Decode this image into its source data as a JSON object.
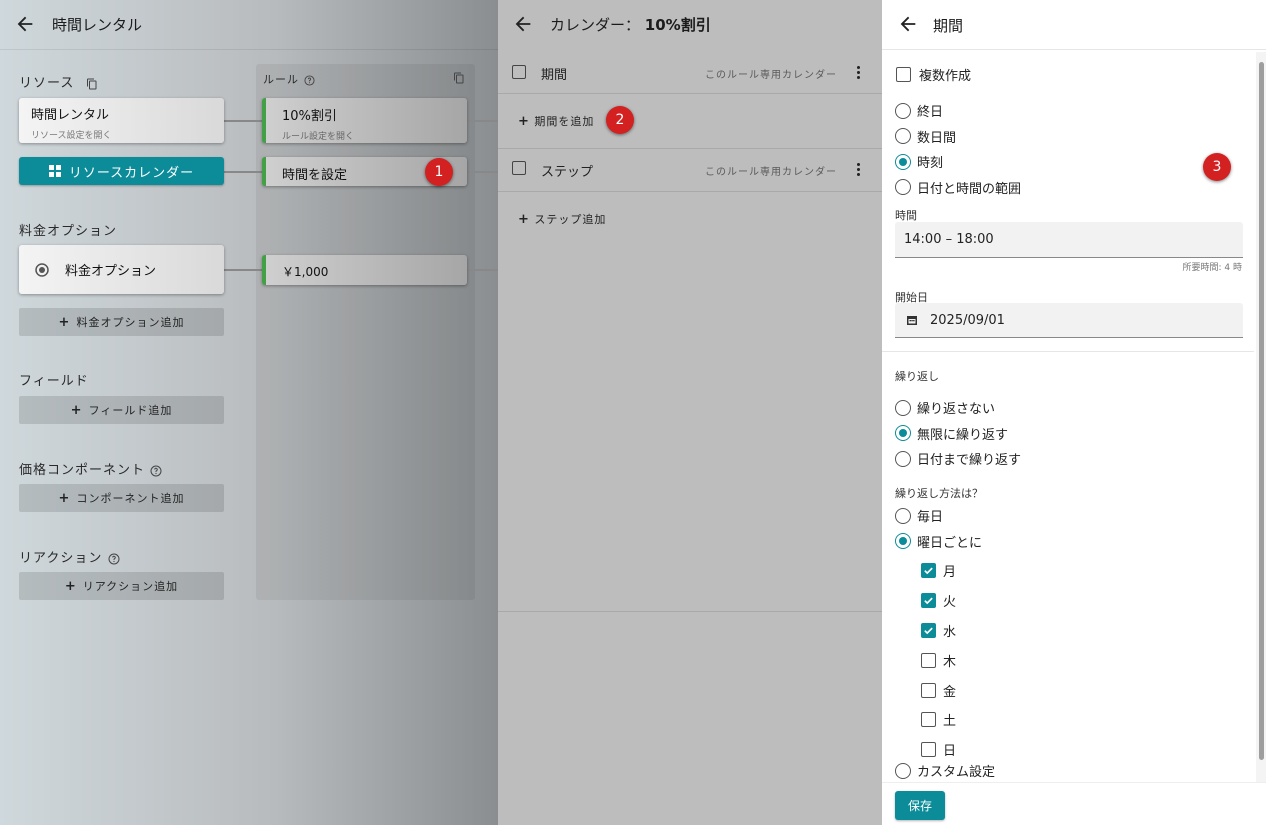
{
  "panel1": {
    "title": "時間レンタル",
    "resources_label": "リソース",
    "rules_label": "ルール",
    "resource_card": {
      "title": "時間レンタル",
      "subtitle": "リソース設定を開く"
    },
    "resource_calendar_button": "リソースカレンダー",
    "rule_card": {
      "title": "10%割引",
      "subtitle": "ルール設定を開く"
    },
    "set_time_card": "時間を設定",
    "price_options_label": "料金オプション",
    "price_option_card": "料金オプション",
    "price_value_card": "￥1,000",
    "add_price_option": "料金オプション追加",
    "fields_label": "フィールド",
    "add_field": "フィールド追加",
    "price_component_label": "価格コンポーネント",
    "add_component": "コンポーネント追加",
    "reaction_label": "リアクション",
    "add_reaction": "リアクション追加"
  },
  "panel2": {
    "title": "カレンダー：",
    "title_rule": "10%割引",
    "period_label": "期間",
    "period_note": "このルール専用カレンダー",
    "add_period": "期間を追加",
    "step_label": "ステップ",
    "step_note": "このルール専用カレンダー",
    "add_step": "ステップ追加"
  },
  "panel3": {
    "title": "期間",
    "multi_create": "複数作成",
    "duration_options": [
      "終日",
      "数日間",
      "時刻",
      "日付と時間の範囲"
    ],
    "duration_selected": "時刻",
    "time_label": "時間",
    "time_value": "14:00 – 18:00",
    "time_hint": "所要時間: 4 時",
    "start_label": "開始日",
    "start_value": "2025/09/01",
    "repeat_label": "繰り返し",
    "repeat_options": [
      "繰り返さない",
      "無限に繰り返す",
      "日付まで繰り返す"
    ],
    "repeat_selected": "無限に繰り返す",
    "method_label": "繰り返し方法は？",
    "method_options": [
      "毎日",
      "曜日ごとに"
    ],
    "method_selected": "曜日ごとに",
    "weekdays": [
      {
        "label": "月",
        "checked": true
      },
      {
        "label": "火",
        "checked": true
      },
      {
        "label": "水",
        "checked": true
      },
      {
        "label": "木",
        "checked": false
      },
      {
        "label": "金",
        "checked": false
      },
      {
        "label": "土",
        "checked": false
      },
      {
        "label": "日",
        "checked": false
      }
    ],
    "custom_label": "カスタム設定",
    "save_label": "保存"
  },
  "badges": [
    "1",
    "2",
    "3"
  ],
  "colors": {
    "accent": "#0c8c99",
    "rule_bar": "#43a047",
    "badge": "#d32020"
  }
}
